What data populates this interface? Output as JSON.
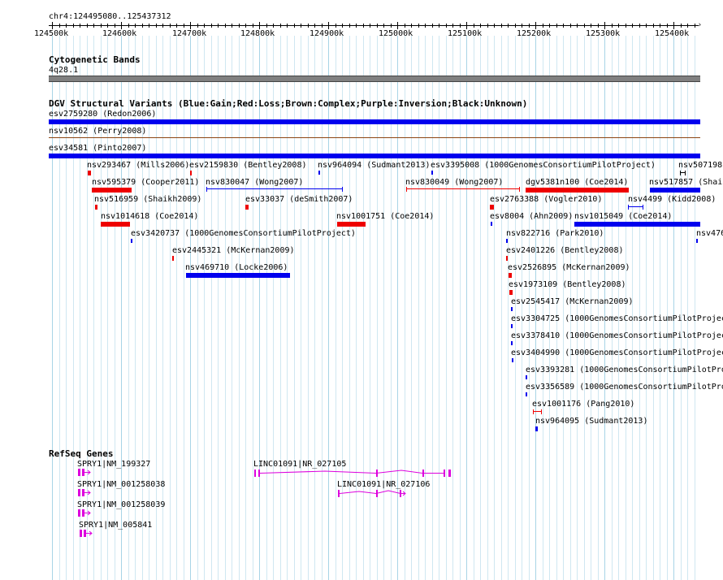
{
  "ruler": {
    "range_label": "chr4:124495080..125437312",
    "ticks": [
      "124500k",
      "124600k",
      "124700k",
      "124800k",
      "124900k",
      "125000k",
      "125100k",
      "125200k",
      "125300k",
      "125400k"
    ]
  },
  "cyto": {
    "title": "Cytogenetic Bands",
    "band": "4q28.1"
  },
  "dgv": {
    "title": "DGV Structural Variants (Blue:Gain;Red:Loss;Brown:Complex;Purple:Inversion;Black:Unknown)",
    "colors": {
      "gain": "#0000ee",
      "loss": "#ee0000",
      "complex": "#8b4513",
      "unknown": "#000000"
    },
    "features": {
      "f01": "esv2759280 (Redon2006)",
      "f02": "nsv10562 (Perry2008)",
      "f03": "esv34581 (Pinto2007)",
      "f04": "nsv293467 (Mills2006)",
      "f05": "esv2159830 (Bentley2008)",
      "f06": "nsv964094 (Sudmant2013)",
      "f07": "esv3395008 (1000GenomesConsortiumPilotProject)",
      "f08": "nsv507198",
      "f09": "nsv595379 (Cooper2011)",
      "f10": "nsv830047 (Wong2007)",
      "f11": "nsv830049 (Wong2007)",
      "f12": "dgv5381n100 (Coe2014)",
      "f13": "nsv517857 (Shai",
      "f14": "nsv516959 (Shaikh2009)",
      "f15": "esv33037 (deSmith2007)",
      "f16": "esv2763388 (Vogler2010)",
      "f17": "nsv4499 (Kidd2008)",
      "f18": "nsv1014618 (Coe2014)",
      "f19": "nsv1001751 (Coe2014)",
      "f20": "esv8004 (Ahn2009)",
      "f21": "nsv1015049 (Coe2014)",
      "f22": "esv3420737 (1000GenomesConsortiumPilotProject)",
      "f23": "nsv822716 (Park2010)",
      "f24": "nsv476",
      "f25": "esv2445321 (McKernan2009)",
      "f26": "esv2401226 (Bentley2008)",
      "f27": "nsv469710 (Locke2006)",
      "f28": "esv2526895 (McKernan2009)",
      "f29": "esv1973109 (Bentley2008)",
      "f30": "esv2545417 (McKernan2009)",
      "f31": "esv3304725 (1000GenomesConsortiumPilotProjec",
      "f32": "esv3378410 (1000GenomesConsortiumPilotProjec",
      "f33": "esv3404990 (1000GenomesConsortiumPilotProjec",
      "f34": "esv3393281 (1000GenomesConsortiumPilotProje",
      "f35": "esv3356589 (1000GenomesConsortiumPilotProje",
      "f36": "esv1001176 (Pang2010)",
      "f37": "nsv964095 (Sudmant2013)"
    }
  },
  "refseq": {
    "title": "RefSeq Genes",
    "gene_color": "#dd00dd",
    "genes": {
      "g1": "SPRY1|NM_199327",
      "g2": "SPRY1|NM_001258038",
      "g3": "SPRY1|NM_001258039",
      "g4": "SPRY1|NM_005841",
      "g5": "LINC01091|NR_027105",
      "g6": "LINC01091|NR_027106"
    }
  }
}
